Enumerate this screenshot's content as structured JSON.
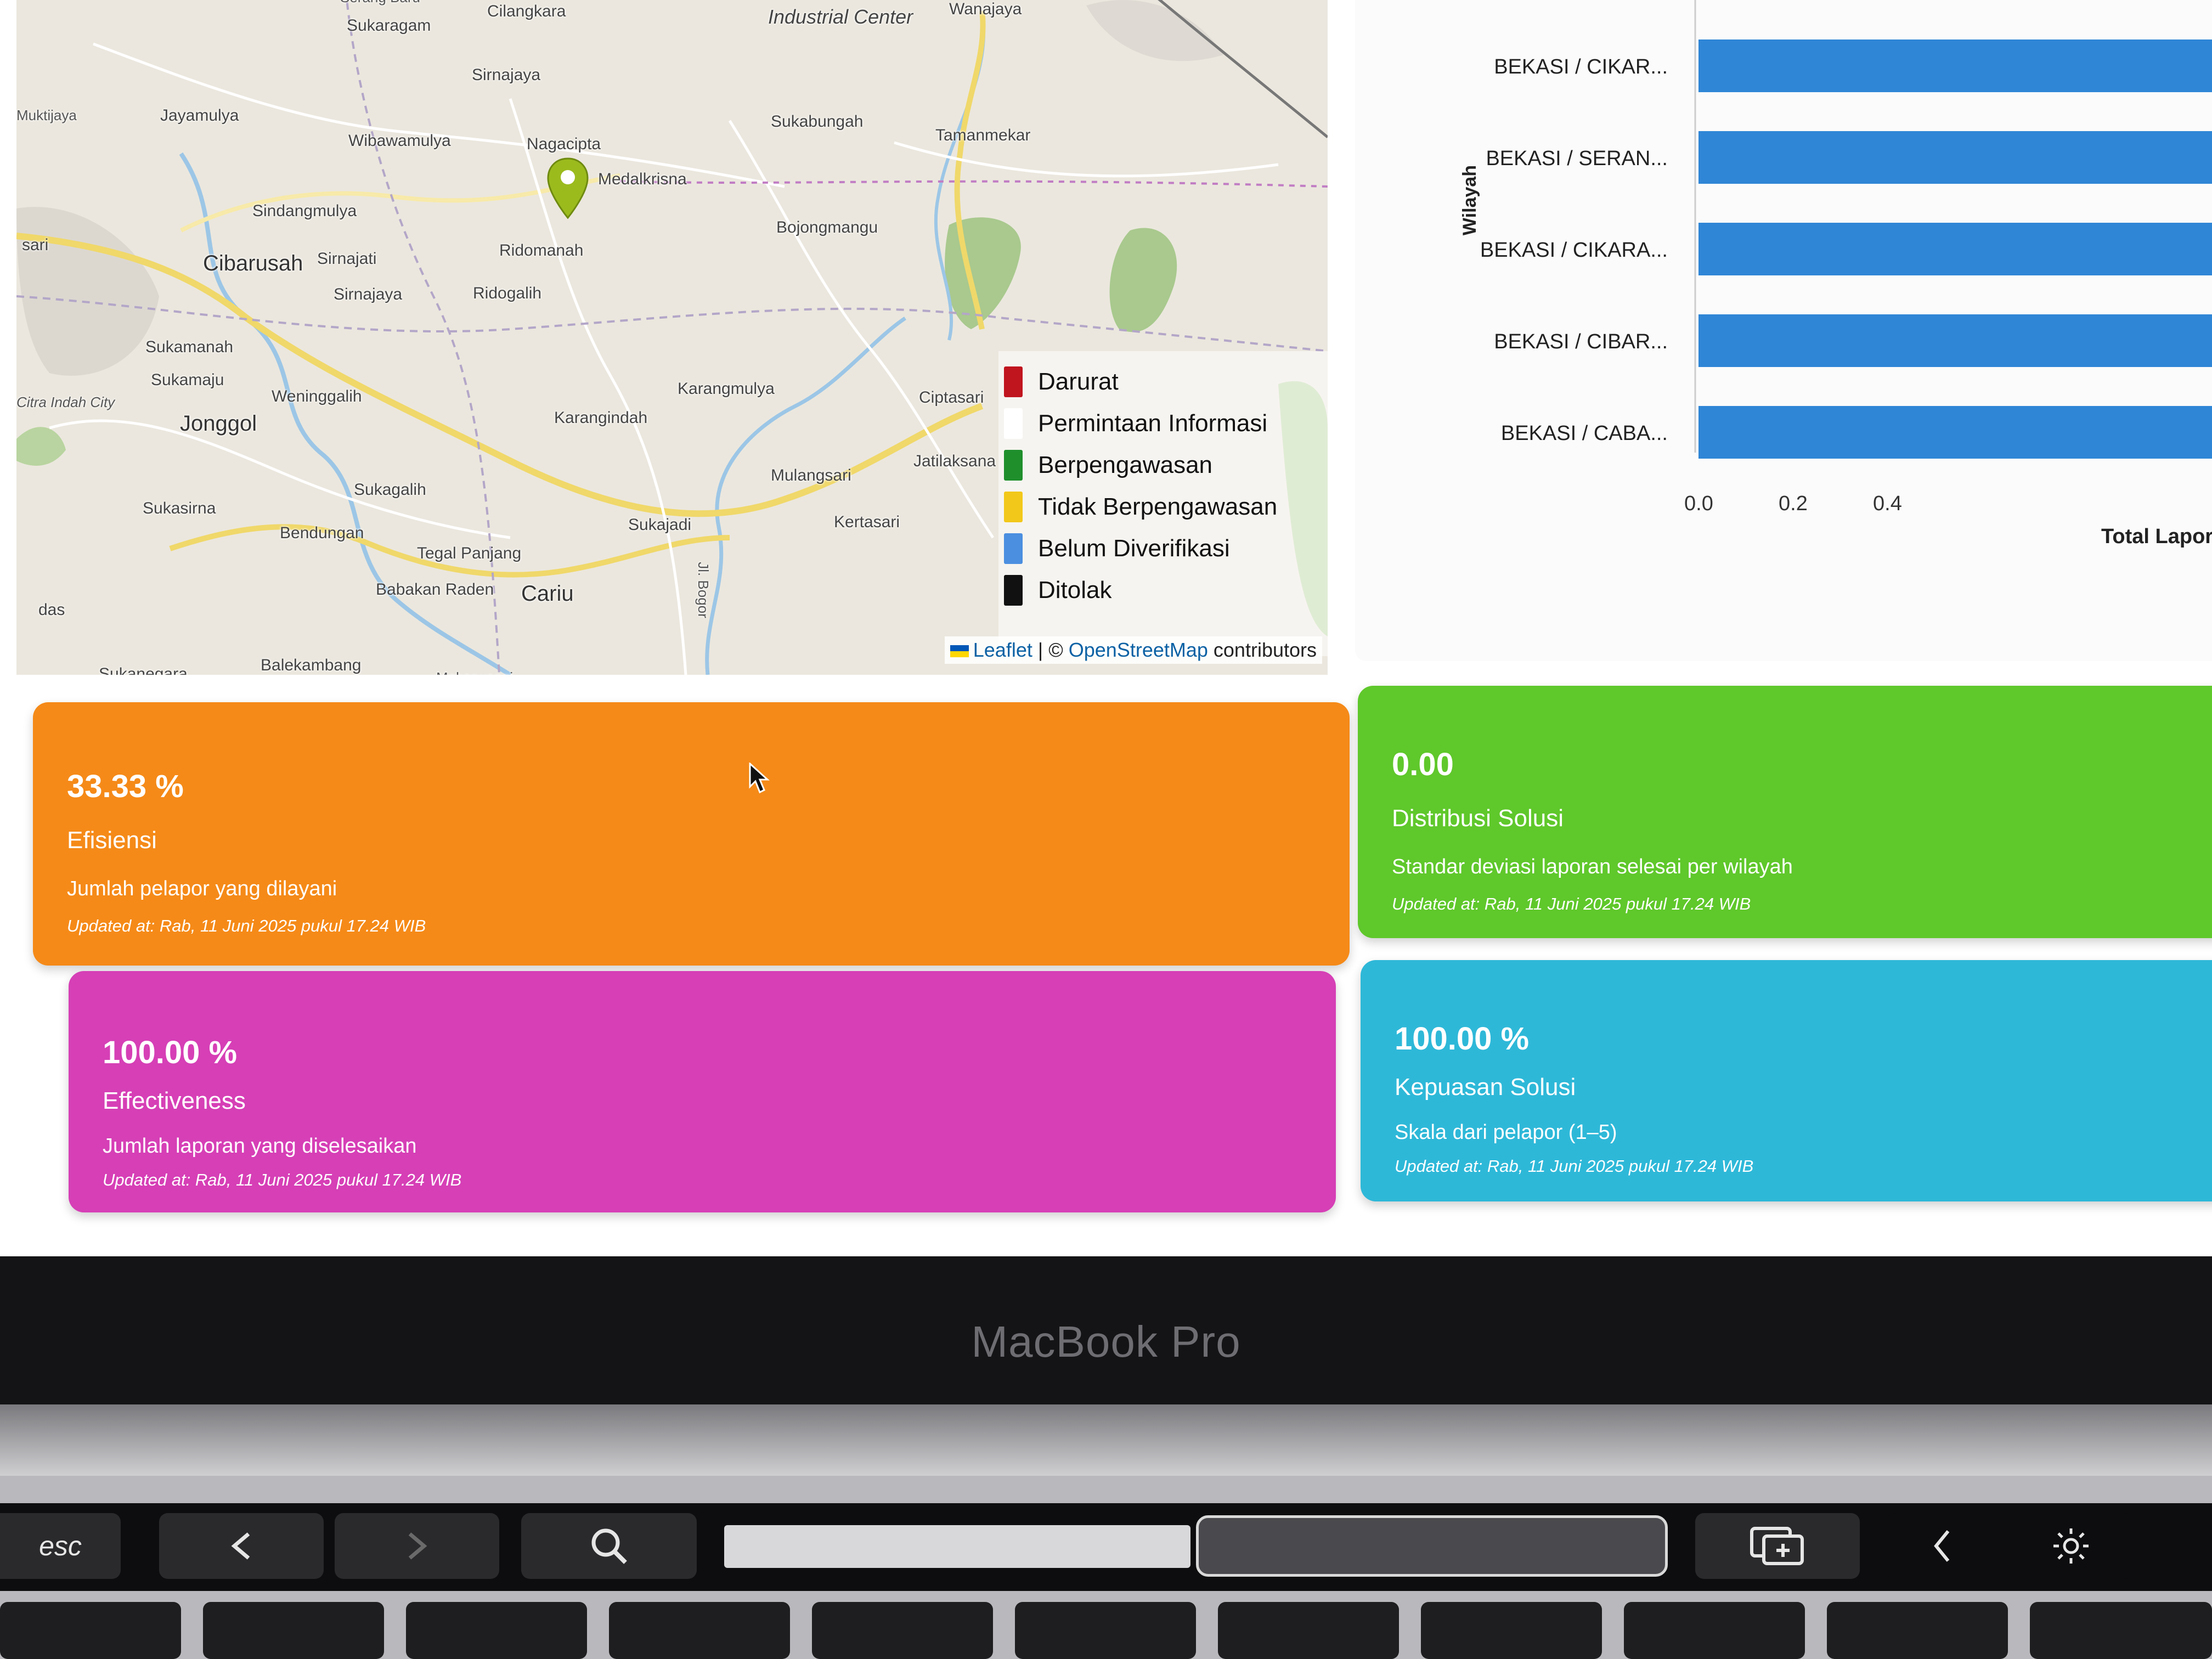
{
  "map": {
    "places": [
      {
        "name": "Serang Baru"
      },
      {
        "name": "Sukaragam"
      },
      {
        "name": "Cilangkara"
      },
      {
        "name": "Industrial Center"
      },
      {
        "name": "Wanajaya"
      },
      {
        "name": "Sirnajaya"
      },
      {
        "name": "Muktijaya"
      },
      {
        "name": "Jayamulya"
      },
      {
        "name": "Wibawamulya"
      },
      {
        "name": "Nagacipta"
      },
      {
        "name": "Sukabungah"
      },
      {
        "name": "Tamanmekar"
      },
      {
        "name": "Medalkrisna"
      },
      {
        "name": "Sindangmulya"
      },
      {
        "name": "Bojongmangu"
      },
      {
        "name": "Cibarusah"
      },
      {
        "name": "Sirnajati"
      },
      {
        "name": "Ridomanah"
      },
      {
        "name": "Sirnajaya"
      },
      {
        "name": "Ridogalih"
      },
      {
        "name": "Sukamanah"
      },
      {
        "name": "Sukamaju"
      },
      {
        "name": "Citra Indah City"
      },
      {
        "name": "Weninggalih"
      },
      {
        "name": "Jonggol"
      },
      {
        "name": "Karangmulya"
      },
      {
        "name": "Karangindah"
      },
      {
        "name": "Ciptasari"
      },
      {
        "name": "Mulangsari"
      },
      {
        "name": "Jatilaksana"
      },
      {
        "name": "Sukagalih"
      },
      {
        "name": "Sukasirna"
      },
      {
        "name": "Bendungan"
      },
      {
        "name": "Sukajadi"
      },
      {
        "name": "Kertasari"
      },
      {
        "name": "Tegal Panjang"
      },
      {
        "name": "Babakan Raden"
      },
      {
        "name": "Cariu"
      },
      {
        "name": "Balekambang"
      },
      {
        "name": "Sukanegara"
      },
      {
        "name": "Mekarwangi"
      },
      {
        "name": "Jl. Bogor"
      },
      {
        "name": "sari"
      },
      {
        "name": "das"
      }
    ],
    "legend": [
      {
        "label": "Darurat",
        "color": "#c0141e"
      },
      {
        "label": "Permintaan Informasi",
        "color": "#ffffff"
      },
      {
        "label": "Berpengawasan",
        "color": "#1f8f2c"
      },
      {
        "label": "Tidak Berpengawasan",
        "color": "#f2c81a"
      },
      {
        "label": "Belum Diverifikasi",
        "color": "#4b8fe0"
      },
      {
        "label": "Ditolak",
        "color": "#111111"
      }
    ],
    "attribution": {
      "leaflet": "Leaflet",
      "separator": " | © ",
      "osm": "OpenStreetMap",
      "suffix": " contributors"
    },
    "marker_color": "#9bbb1d"
  },
  "chart_data": {
    "type": "bar",
    "orientation": "horizontal",
    "categories": [
      "BEKASI / CIKAR...",
      "BEKASI / SERAN...",
      "BEKASI / CIKARA...",
      "BEKASI / CIBAR...",
      "BEKASI / CABA..."
    ],
    "values": [
      1,
      1,
      1,
      1,
      1
    ],
    "xlabel": "Total Lapora",
    "ylabel": "Wilayah",
    "xticks": [
      "0.0",
      "0.2",
      "0.4"
    ],
    "xlim": [
      0,
      1
    ],
    "bar_color": "#2f86d6"
  },
  "cards": {
    "efisiensi": {
      "value": "33.33 %",
      "title": "Efisiensi",
      "desc": "Jumlah pelapor yang dilayani",
      "updated": "Updated at: Rab, 11 Juni 2025 pukul 17.24 WIB"
    },
    "distribusi": {
      "value": "0.00",
      "title": "Distribusi Solusi",
      "desc": "Standar deviasi laporan selesai per wilayah",
      "updated": "Updated at: Rab, 11 Juni 2025 pukul 17.24 WIB"
    },
    "effectiveness": {
      "value": "100.00 %",
      "title": "Effectiveness",
      "desc": "Jumlah laporan yang diselesaikan",
      "updated": "Updated at: Rab, 11 Juni 2025 pukul 17.24 WIB"
    },
    "kepuasan": {
      "value": "100.00 %",
      "title": "Kepuasan Solusi",
      "desc": "Skala dari pelapor (1–5)",
      "updated": "Updated at: Rab, 11 Juni 2025 pukul 17.24 WIB"
    }
  },
  "laptop": {
    "brand": "MacBook Pro",
    "touchbar": {
      "esc": "esc",
      "back": "<",
      "forward": ">",
      "search": "search-icon",
      "brightness": "brightness-icon"
    }
  }
}
